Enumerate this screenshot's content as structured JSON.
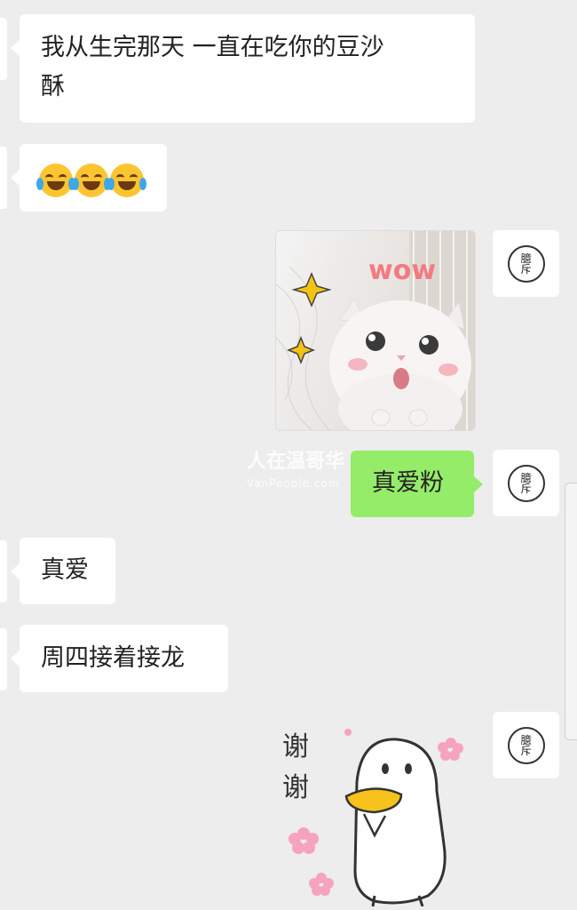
{
  "messages": [
    {
      "side": "left",
      "text": "我从生完那天 一直在吃你的豆沙酥",
      "line1": "我从生完那天 一直在吃你的豆沙",
      "line2": "酥"
    },
    {
      "side": "left",
      "type": "emoji",
      "emoji": "face-with-tears-of-joy",
      "count": 3
    },
    {
      "side": "right",
      "type": "image",
      "sticker_text": "wow"
    },
    {
      "side": "right",
      "text": "真爱粉"
    },
    {
      "side": "left",
      "text": "真爱"
    },
    {
      "side": "left",
      "text": "周四接着接龙"
    },
    {
      "side": "right",
      "type": "sticker",
      "sticker_text": "谢谢"
    }
  ],
  "avatar": {
    "seal_text": "臆斥"
  },
  "watermark": {
    "title": "人在温哥华",
    "subtitle": "VanPeople.com"
  },
  "colors": {
    "background": "#ededed",
    "left_bubble": "#ffffff",
    "right_bubble": "#95ec69"
  }
}
